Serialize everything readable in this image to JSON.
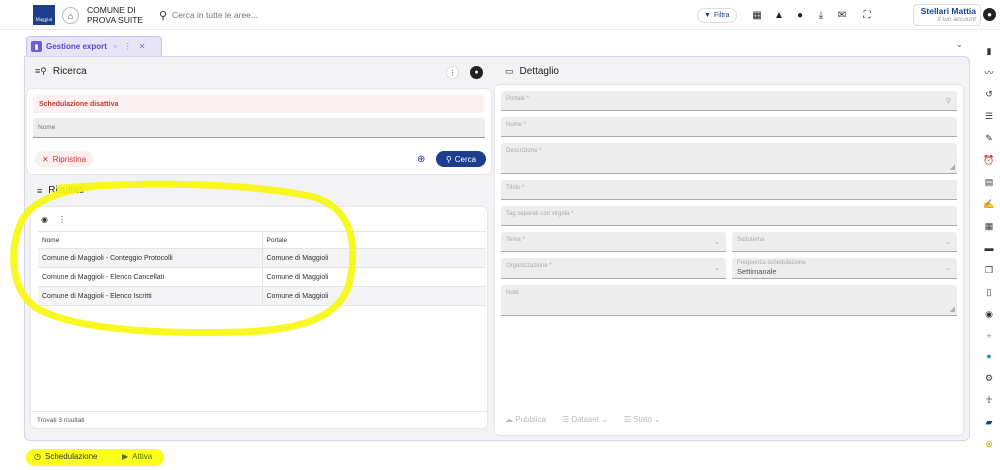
{
  "header": {
    "logo_text": "Maggiol",
    "comune_line1": "COMUNE DI",
    "comune_line2": "PROVA SUITE",
    "search_placeholder": "Cerca in tutte le aree...",
    "filter_label": "Filtra",
    "user_name": "Stellari Mattia",
    "user_subtitle": "Il tuo account"
  },
  "tabs": [
    {
      "label": "Gestione export"
    }
  ],
  "ricerca": {
    "title": "Ricerca",
    "alert": "Schedulazione disattiva",
    "name_placeholder": "Nome",
    "reset_label": "Ripristina",
    "search_label": "Cerca"
  },
  "risultati": {
    "title": "Risultati",
    "columns": [
      "Nome",
      "Portale"
    ],
    "rows": [
      [
        "Comune di Maggioli - Conteggio Protocolli",
        "Comune di Maggioli"
      ],
      [
        "Comune di Maggioli - Elenco Cancellati",
        "Comune di Maggioli"
      ],
      [
        "Comune di Maggioli - Elenco Iscritti",
        "Comune di Maggioli"
      ]
    ],
    "footer": "Trovati 3 risultati"
  },
  "dettaglio": {
    "title": "Dettaglio",
    "fields": {
      "portale": "Portale *",
      "nome": "Nome *",
      "descrizione": "Descrizione *",
      "titolo": "Titolo *",
      "tag": "Tag separati con virgola *",
      "tema": "Tema *",
      "sottotema": "Sottotema",
      "organizzazione": "Organizzazione *",
      "frequenza_label": "Frequenza schedulazione",
      "frequenza_value": "Settimanale",
      "note": "Note"
    },
    "actions": [
      "Pubblica",
      "Dataset",
      "Stato"
    ]
  },
  "footer": {
    "schedulazione": "Schedulazione",
    "attiva": "Attiva"
  },
  "colors": {
    "primary": "#1c3e8c",
    "tab_accent": "#6f5bd3",
    "alert": "#c0392b",
    "highlight": "#fbff1e"
  }
}
